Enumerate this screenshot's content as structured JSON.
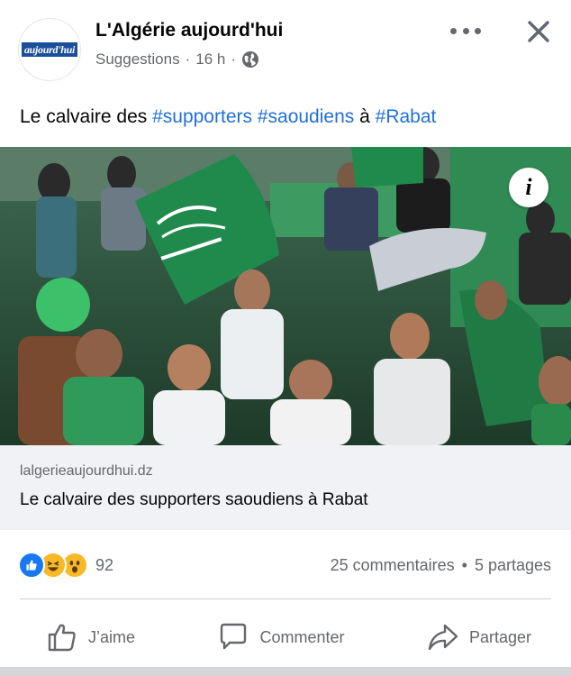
{
  "post": {
    "page_name": "L'Algérie aujourd'hui",
    "avatar_logo_text": "aujourd'hui",
    "meta_source": "Suggestions",
    "meta_sep1": "·",
    "meta_time": "16 h",
    "meta_sep2": "·",
    "caption_prefix": "Le calvaire des ",
    "hashtags": [
      "#supporters",
      "#saoudiens",
      "#Rabat"
    ],
    "caption_connector": "à",
    "more_icon": "more-dots-icon",
    "close_icon": "close-icon",
    "audience_icon": "globe-icon"
  },
  "link": {
    "domain": "lalgerieaujourdhui.dz",
    "title": "Le calvaire des supporters saoudiens à Rabat"
  },
  "engagement": {
    "reaction_icons": [
      "like-icon",
      "haha-icon",
      "wow-icon"
    ],
    "reaction_count": "92",
    "comments": "25 commentaires",
    "separator": "•",
    "shares": "5 partages"
  },
  "actions": {
    "like": "J’aime",
    "comment": "Commenter",
    "share": "Partager"
  },
  "colors": {
    "hashtag": "#216fdb",
    "secondary_text": "#65676b",
    "link_box_bg": "#f0f2f5",
    "saudi_green": "#1f8a4c"
  }
}
